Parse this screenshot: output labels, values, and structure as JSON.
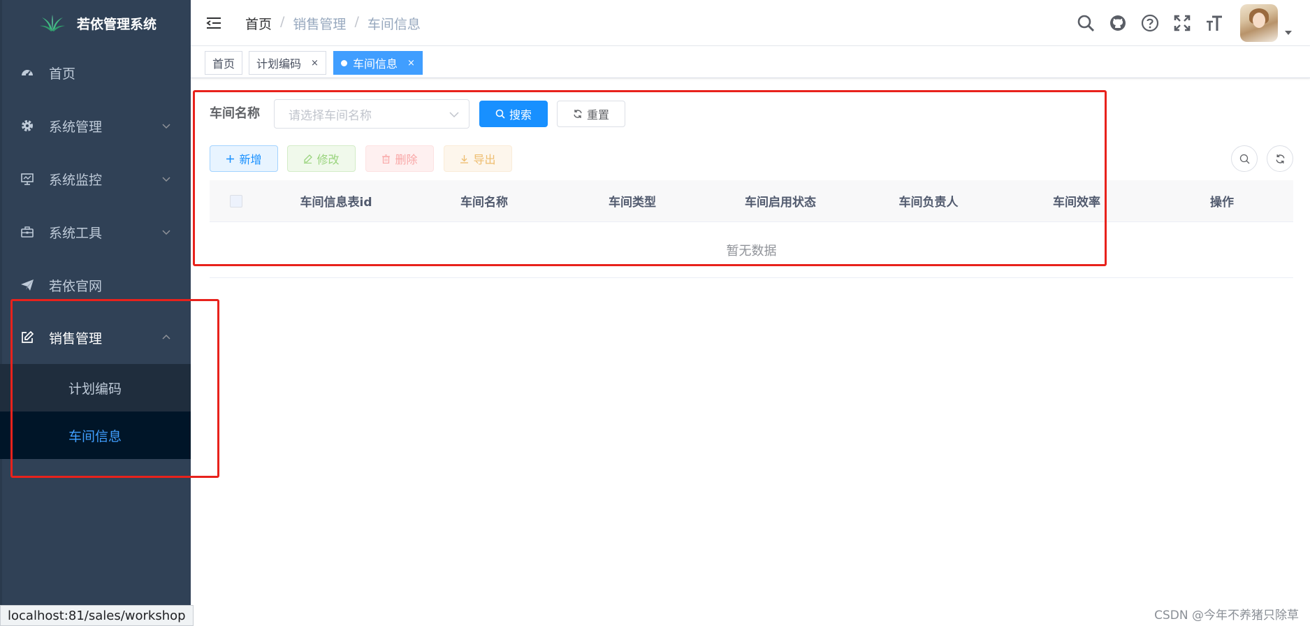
{
  "app": {
    "title": "若依管理系统"
  },
  "sidebar": {
    "items": [
      {
        "label": "首页",
        "icon": "dashboard-icon"
      },
      {
        "label": "系统管理",
        "icon": "gear-icon"
      },
      {
        "label": "系统监控",
        "icon": "monitor-icon"
      },
      {
        "label": "系统工具",
        "icon": "toolbox-icon"
      },
      {
        "label": "若依官网",
        "icon": "paper-plane-icon"
      },
      {
        "label": "销售管理",
        "icon": "edit-icon",
        "expanded": true
      }
    ],
    "submenu": [
      {
        "label": "计划编码"
      },
      {
        "label": "车间信息",
        "selected": true
      }
    ]
  },
  "navbar": {
    "breadcrumb": [
      "首页",
      "销售管理",
      "车间信息"
    ],
    "breadcrumb_separator": "/",
    "icons": [
      "search-icon",
      "github-icon",
      "help-icon",
      "fullscreen-icon",
      "font-size-icon"
    ]
  },
  "tags": [
    {
      "label": "首页",
      "active": false
    },
    {
      "label": "计划编码",
      "active": false,
      "close": "×"
    },
    {
      "label": "车间信息",
      "active": true,
      "close": "×"
    }
  ],
  "query_form": {
    "label": "车间名称",
    "select_placeholder": "请选择车间名称",
    "search_button": "搜索",
    "reset_button": "重置"
  },
  "toolbar": {
    "add": "新增",
    "edit": "修改",
    "delete": "删除",
    "export": "导出"
  },
  "table": {
    "columns": [
      "车间信息表id",
      "车间名称",
      "车间类型",
      "车间启用状态",
      "车间负责人",
      "车间效率",
      "操作"
    ],
    "empty_text": "暂无数据"
  },
  "statusbar": {
    "url": "localhost:81/sales/workshop"
  },
  "watermark": "CSDN @今年不养猪只除草",
  "colors": {
    "sidebar_bg": "#304156",
    "primary": "#1890ff",
    "annotation_red": "#e8221c"
  }
}
